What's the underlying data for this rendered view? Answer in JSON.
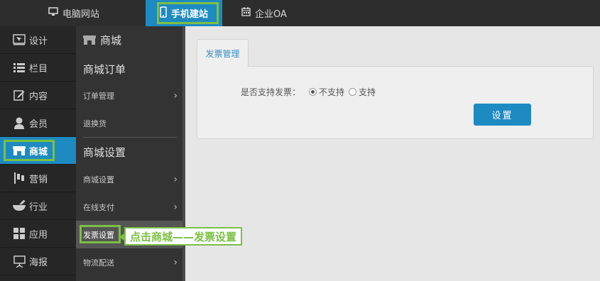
{
  "topbar": {
    "tabs": [
      {
        "label": "电脑网站",
        "icon": "monitor-icon"
      },
      {
        "label": "手机建站",
        "icon": "mobile-icon"
      },
      {
        "label": "企业OA",
        "icon": "calendar-icon"
      }
    ]
  },
  "leftnav": {
    "items": [
      {
        "label": "设计",
        "icon": "design-icon"
      },
      {
        "label": "栏目",
        "icon": "list-icon"
      },
      {
        "label": "内容",
        "icon": "edit-icon"
      },
      {
        "label": "会员",
        "icon": "user-icon"
      },
      {
        "label": "商城",
        "icon": "shop-icon"
      },
      {
        "label": "营销",
        "icon": "flag-icon"
      },
      {
        "label": "行业",
        "icon": "bowl-icon"
      },
      {
        "label": "应用",
        "icon": "grid-icon"
      },
      {
        "label": "海报",
        "icon": "poster-icon"
      }
    ]
  },
  "subnav": {
    "title": "商城",
    "section1": "商城订单",
    "item_order": "订单管理",
    "item_return": "退换货",
    "section2": "商城设置",
    "item_settings": "商城设置",
    "item_payment": "在线支付",
    "item_invoice": "发票设置",
    "item_logistics": "物流配送"
  },
  "callout": {
    "text": "点击商城——发票设置"
  },
  "main": {
    "tab_label": "发票管理",
    "field_label": "是否支持发票：",
    "option_no": "不支持",
    "option_yes": "支持",
    "button_label": "设置"
  },
  "colors": {
    "accent": "#1e8ac2",
    "highlight": "#7bc043"
  }
}
